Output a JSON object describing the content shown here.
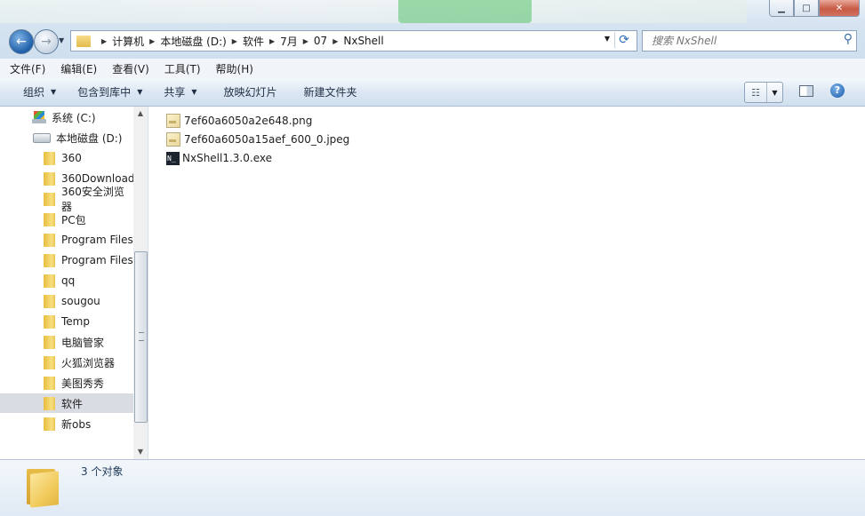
{
  "window": {
    "minimize_glyph": "▁",
    "maximize_glyph": "□",
    "close_glyph": "✕"
  },
  "address": {
    "crumbs": [
      "计算机",
      "本地磁盘 (D:)",
      "软件",
      "7月",
      "07",
      "NxShell"
    ]
  },
  "search": {
    "placeholder": "搜索 NxShell"
  },
  "menu": {
    "items": [
      "文件(F)",
      "编辑(E)",
      "查看(V)",
      "工具(T)",
      "帮助(H)"
    ]
  },
  "toolbar": {
    "organize": "组织",
    "include_library": "包含到库中",
    "share": "共享",
    "slideshow": "放映幻灯片",
    "new_folder": "新建文件夹"
  },
  "navpane": {
    "drives": [
      {
        "label": "系统 (C:)"
      },
      {
        "label": "本地磁盘 (D:)"
      }
    ],
    "folders": [
      "360",
      "360Download",
      "360安全浏览器",
      "PC包",
      "Program Files",
      "Program Files",
      "qq",
      "sougou",
      "Temp",
      "电脑管家",
      "火狐浏览器",
      "美图秀秀",
      "软件",
      "新obs"
    ],
    "selected": "软件"
  },
  "files": [
    {
      "name": "7ef60a6050a2e648.png",
      "icon": "image-file-icon"
    },
    {
      "name": "7ef60a6050a15aef_600_0.jpeg",
      "icon": "image-file-icon"
    },
    {
      "name": "NxShell1.3.0.exe",
      "icon": "nxshell-app-icon",
      "badge": "N_"
    }
  ],
  "status": {
    "count": "3 个对象"
  },
  "colors": {
    "accent": "#2f6db7",
    "selection": "#d9dde3"
  }
}
